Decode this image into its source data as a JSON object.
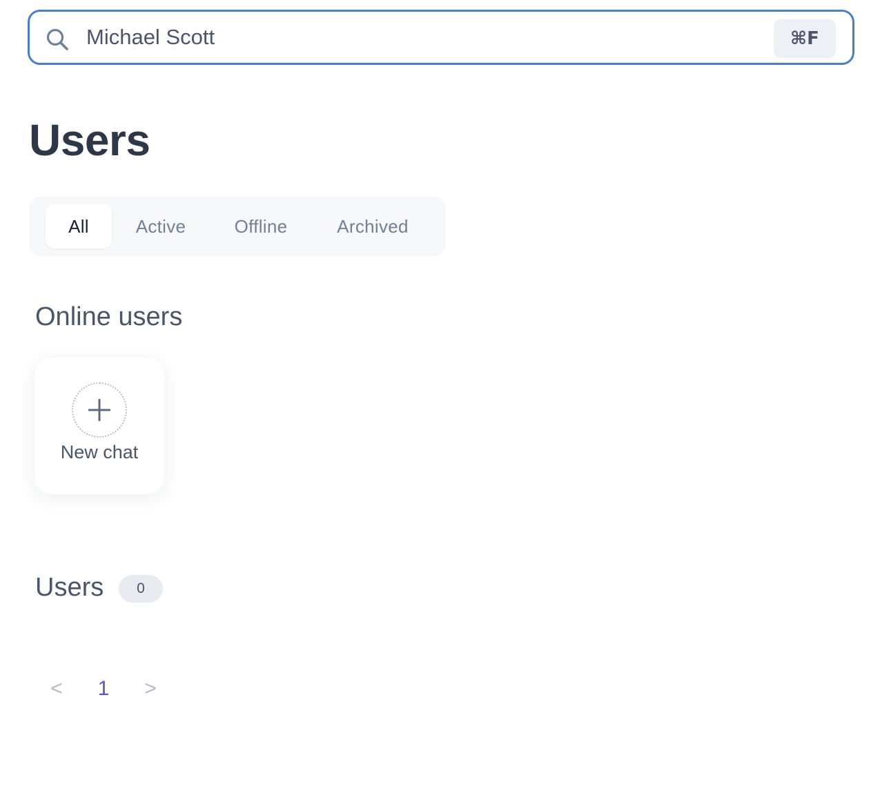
{
  "search": {
    "value": "Michael Scott",
    "shortcut": "⌘F"
  },
  "page": {
    "title": "Users"
  },
  "tabs": [
    {
      "label": "All",
      "active": true
    },
    {
      "label": "Active",
      "active": false
    },
    {
      "label": "Offline",
      "active": false
    },
    {
      "label": "Archived",
      "active": false
    }
  ],
  "online_users": {
    "heading": "Online users",
    "new_chat_label": "New chat"
  },
  "users_section": {
    "heading": "Users",
    "count": "0"
  },
  "pagination": {
    "prev": "<",
    "current_page": "1",
    "next": ">"
  },
  "colors": {
    "accent_border": "#4a7fc1",
    "active_page": "#5a55c8",
    "text_primary": "#2d3748",
    "text_muted": "#718096"
  },
  "icons": {
    "search": "search-icon",
    "plus": "plus-icon"
  }
}
